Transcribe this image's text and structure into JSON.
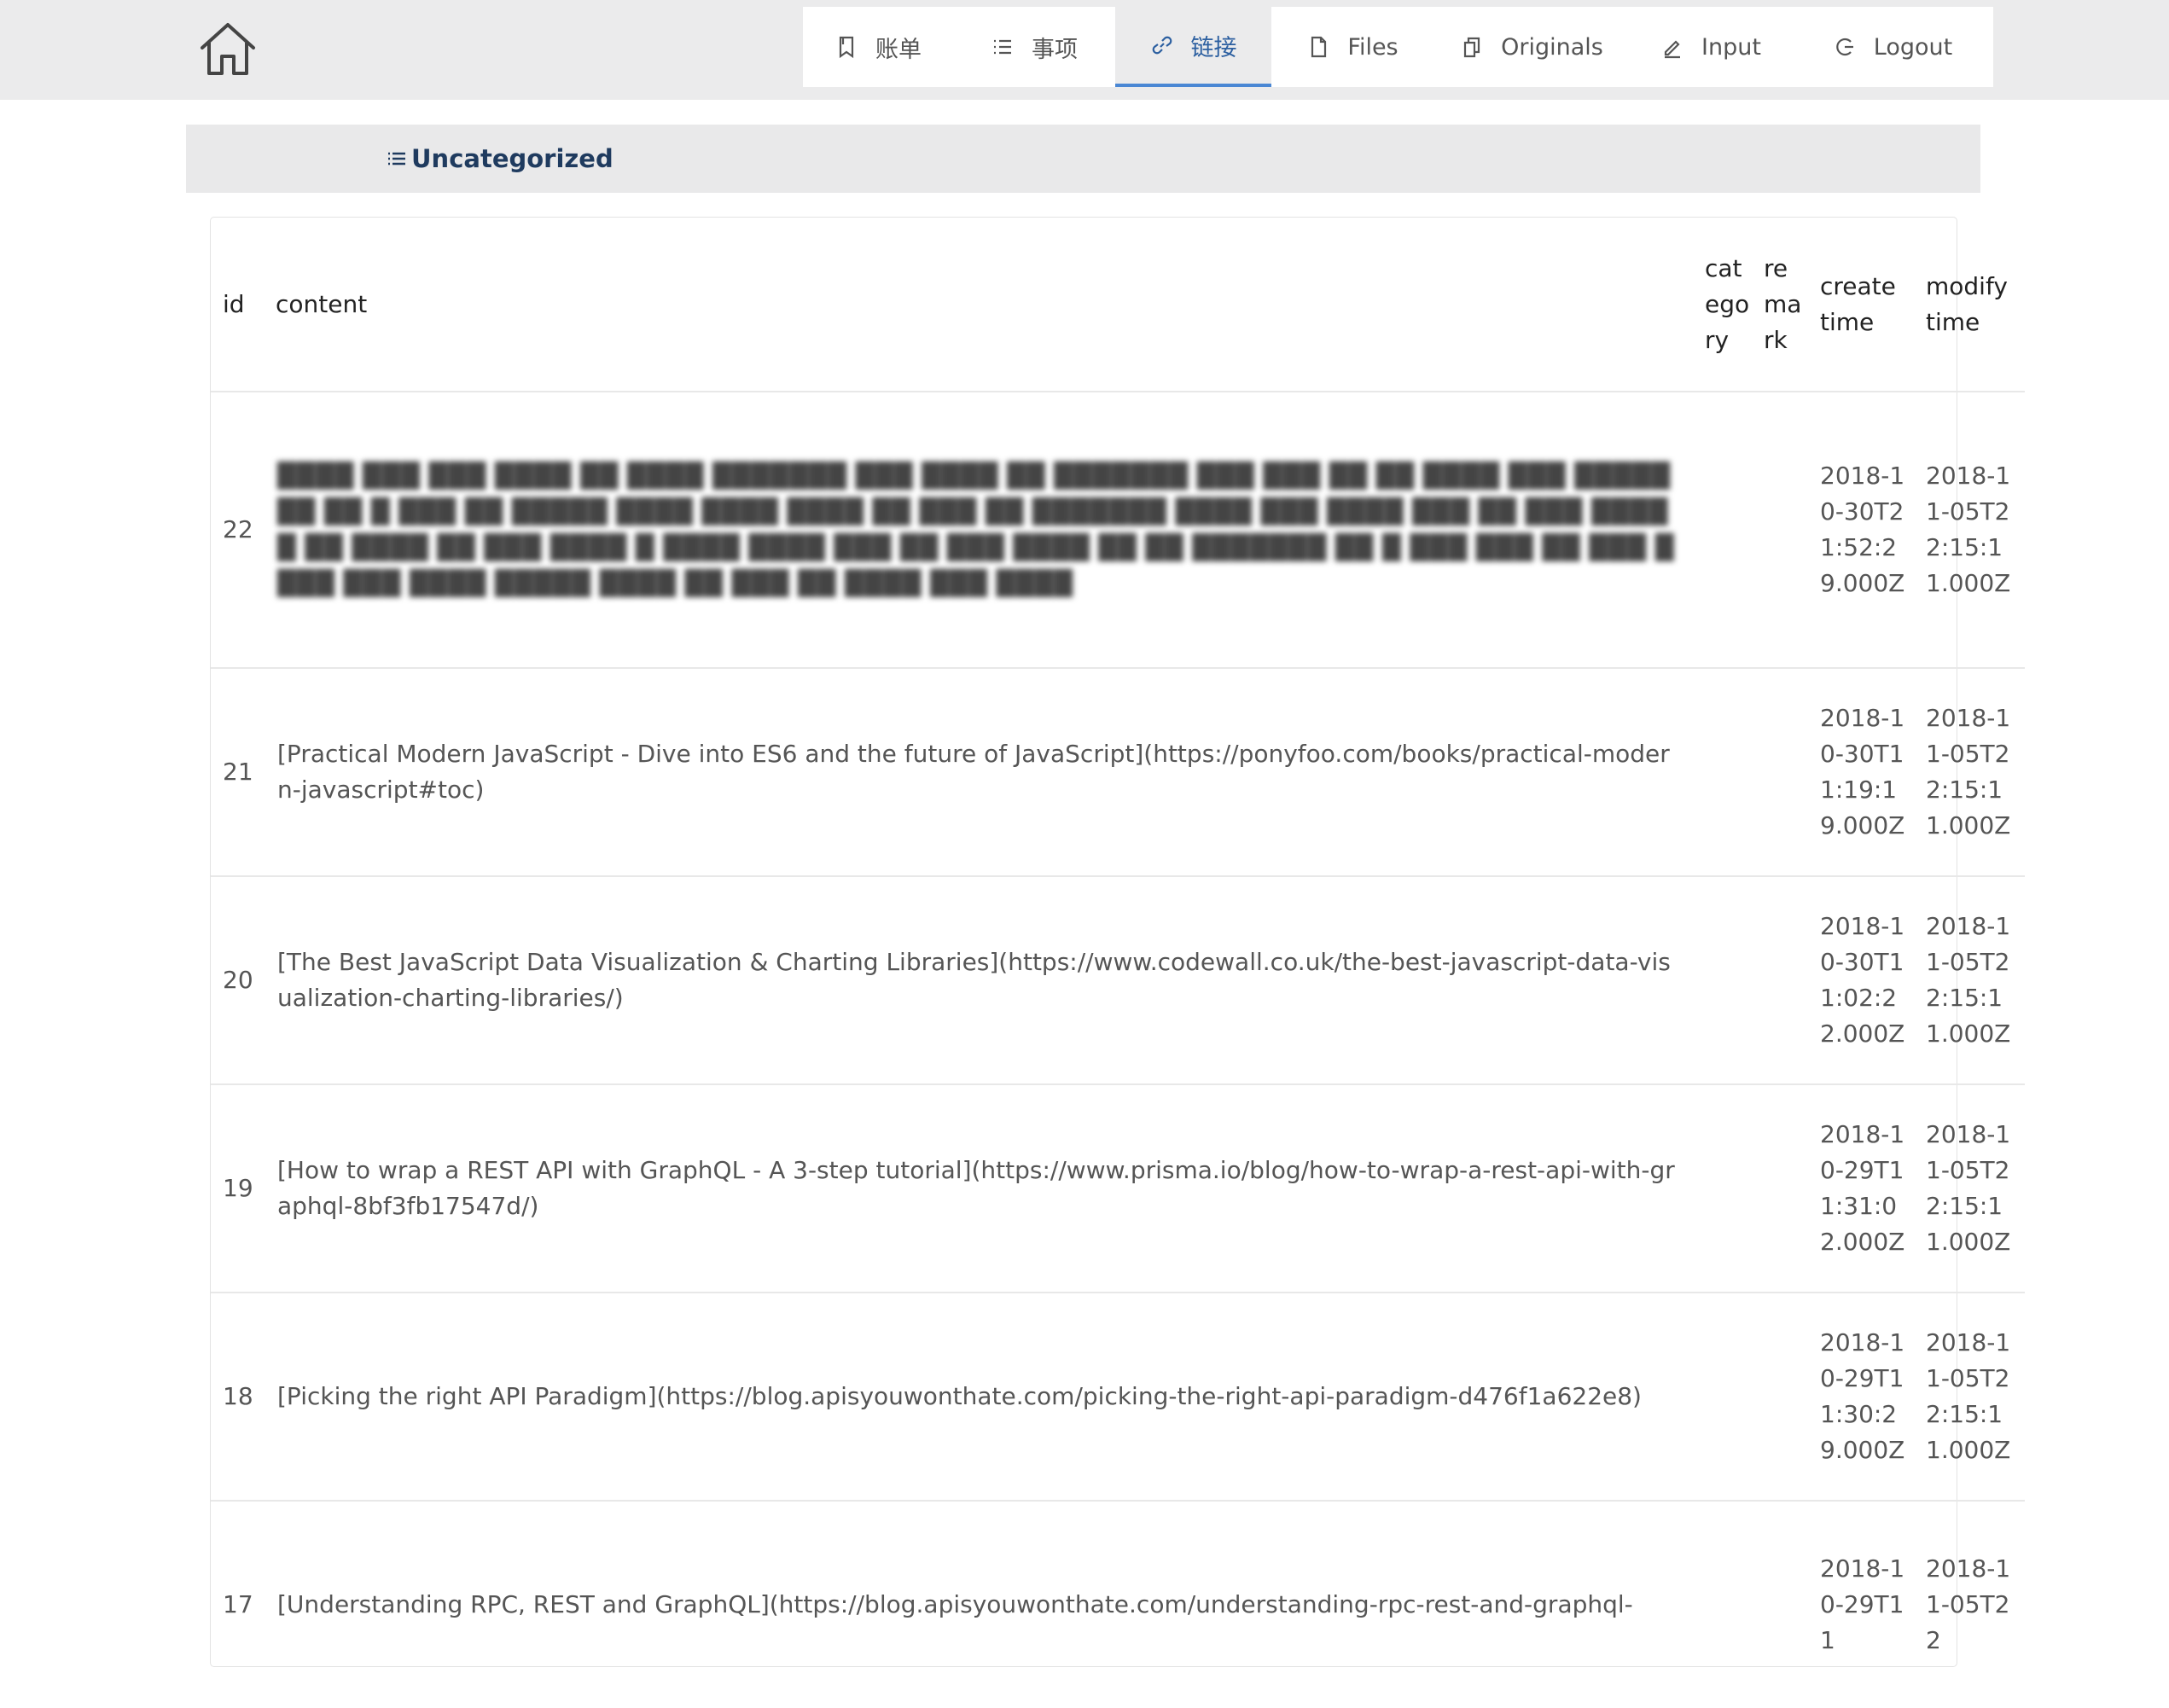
{
  "nav": {
    "tabs": [
      {
        "label": "账单",
        "icon": "bookmark-icon",
        "active": false
      },
      {
        "label": "事项",
        "icon": "list-icon",
        "active": false
      },
      {
        "label": "链接",
        "icon": "link-icon",
        "active": true
      },
      {
        "label": "Files",
        "icon": "file-icon",
        "active": false
      },
      {
        "label": "Originals",
        "icon": "copy-icon",
        "active": false
      },
      {
        "label": "Input",
        "icon": "pencil-icon",
        "active": false
      },
      {
        "label": "Logout",
        "icon": "logout-icon",
        "active": false
      }
    ],
    "accent_color": "#4a87d4"
  },
  "category": {
    "title": "Uncategorized",
    "icon": "list-icon"
  },
  "table": {
    "headers": {
      "id": "id",
      "content": "content",
      "category": "category",
      "remark": "remark",
      "create_time": "create time",
      "modify_time": "modify time"
    },
    "rows": [
      {
        "id": "22",
        "content": "████ ███ ███ ████ ██ ████ ███████ ███ ████ ██ ███████ ███ ███ ██ ██ ████ ███ ███████ ██ █ ███ ██ █████ ████ ████ ████ ██ ███ ██ ███████ ████ ███ ████ ███ ██ ███ █████ ██ ████ ██ ███ ████ █ ████ ████ ███ ██ ███ ████ ██ ██ ███████ ██ █ ███ ███ ██ ███ ████ ███ ████ █████ ████ ██ ███ ██ ████ ███ ████",
        "category": "",
        "remark": "",
        "create_time": "2018-10-30T21:52:29.000Z",
        "modify_time": "2018-11-05T22:15:11.000Z"
      },
      {
        "id": "21",
        "content": "[Practical Modern JavaScript - Dive into ES6 and the future of JavaScript](https://ponyfoo.com/books/practical-modern-javascript#toc)",
        "category": "",
        "remark": "",
        "create_time": "2018-10-30T11:19:19.000Z",
        "modify_time": "2018-11-05T22:15:11.000Z"
      },
      {
        "id": "20",
        "content": "[The Best JavaScript Data Visualization & Charting Libraries](https://www.codewall.co.uk/the-best-javascript-data-visualization-charting-libraries/)",
        "category": "",
        "remark": "",
        "create_time": "2018-10-30T11:02:22.000Z",
        "modify_time": "2018-11-05T22:15:11.000Z"
      },
      {
        "id": "19",
        "content": "[How to wrap a REST API with GraphQL - A 3-step tutorial](https://www.prisma.io/blog/how-to-wrap-a-rest-api-with-graphql-8bf3fb17547d/)",
        "category": "",
        "remark": "",
        "create_time": "2018-10-29T11:31:02.000Z",
        "modify_time": "2018-11-05T22:15:11.000Z"
      },
      {
        "id": "18",
        "content": "[Picking the right API Paradigm](https://blog.apisyouwonthate.com/picking-the-right-api-paradigm-d476f1a622e8)",
        "category": "",
        "remark": "",
        "create_time": "2018-10-29T11:30:29.000Z",
        "modify_time": "2018-11-05T22:15:11.000Z"
      },
      {
        "id": "17",
        "content": "[Understanding RPC, REST and GraphQL](https://blog.apisyouwonthate.com/understanding-rpc-rest-and-graphql-",
        "category": "",
        "remark": "",
        "create_time": "2018-10-29T11",
        "modify_time": "2018-11-05T22"
      }
    ]
  }
}
